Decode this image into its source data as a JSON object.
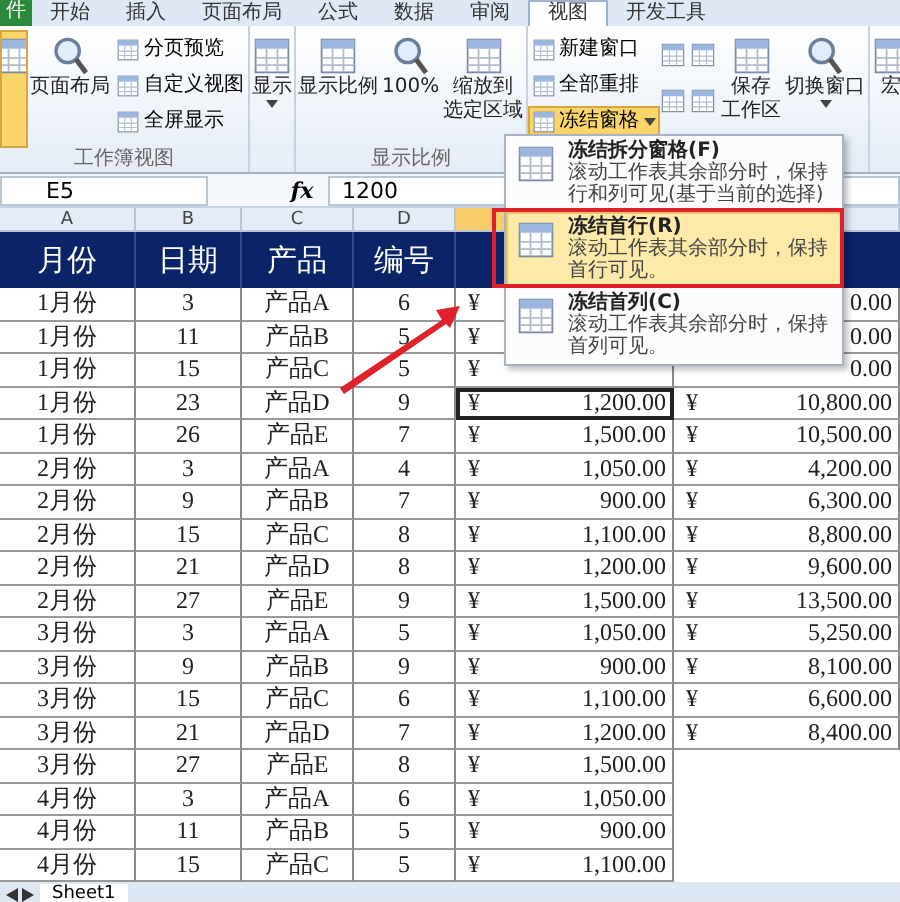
{
  "ribbon": {
    "file_tab": "件",
    "tabs": [
      {
        "label": "开始",
        "selected": false
      },
      {
        "label": "插入",
        "selected": false
      },
      {
        "label": "页面布局",
        "selected": false
      },
      {
        "label": "公式",
        "selected": false
      },
      {
        "label": "数据",
        "selected": false
      },
      {
        "label": "审阅",
        "selected": false
      },
      {
        "label": "视图",
        "selected": true
      },
      {
        "label": "开发工具",
        "selected": false
      }
    ],
    "groups": [
      {
        "label": "工作簿视图",
        "items": [
          {
            "kind": "large",
            "selected": true
          },
          {
            "kind": "large",
            "label": "页面布局",
            "selected": false
          },
          {
            "kind": "stack",
            "items": [
              {
                "label": "分页预览",
                "open": false
              },
              {
                "label": "自定义视图",
                "open": false
              },
              {
                "label": "全屏显示",
                "open": false
              }
            ]
          }
        ]
      },
      {
        "items": [
          {
            "kind": "large",
            "label": "显示",
            "selected": false,
            "dropdown": true
          }
        ]
      },
      {
        "label": "显示比例",
        "items": [
          {
            "kind": "large",
            "label": "显示比例",
            "selected": false
          },
          {
            "kind": "large",
            "label": "100%",
            "selected": false
          },
          {
            "kind": "large",
            "label": [
              "缩放到",
              "选定区域"
            ],
            "selected": false
          }
        ]
      },
      {
        "items": [
          {
            "kind": "stack",
            "items": [
              {
                "label": "新建窗口",
                "open": false
              },
              {
                "label": "全部重排",
                "open": false
              },
              {
                "label": "冻结窗格",
                "open": true,
                "dropdown": true
              }
            ]
          },
          {
            "kind": "icons"
          },
          {
            "kind": "icons"
          },
          {
            "kind": "large",
            "label": [
              "保存",
              "工作区"
            ],
            "selected": false
          },
          {
            "kind": "large",
            "label": "切换窗口",
            "selected": false,
            "dropdown": true
          }
        ]
      },
      {
        "items": [
          {
            "kind": "large",
            "label": "宏",
            "selected": false
          }
        ]
      }
    ]
  },
  "formula_bar": {
    "name_box": "E5",
    "function_label": "fx",
    "formula": "1200"
  },
  "columns": [
    {
      "label": "A",
      "selected": false
    },
    {
      "label": "B",
      "selected": false
    },
    {
      "label": "C",
      "selected": false
    },
    {
      "label": "D",
      "selected": false
    },
    {
      "selected": true
    },
    {
      "selected": false
    }
  ],
  "table": {
    "headers": [
      "月份",
      "日期",
      "产品",
      "编号"
    ],
    "rows": [
      {
        "month": "1月份",
        "day": "3",
        "product": "产品A",
        "number": "6",
        "e": {
          "currency": "¥"
        },
        "f": {
          "amount": "0.00"
        },
        "active": false
      },
      {
        "month": "1月份",
        "day": "11",
        "product": "产品B",
        "number": "5",
        "e": {
          "currency": "¥"
        },
        "f": {
          "amount": "0.00"
        },
        "active": false
      },
      {
        "month": "1月份",
        "day": "15",
        "product": "产品C",
        "number": "5",
        "e": {
          "currency": "¥"
        },
        "f": {
          "amount": "0.00"
        },
        "active": false
      },
      {
        "month": "1月份",
        "day": "23",
        "product": "产品D",
        "number": "9",
        "e": {
          "currency": "¥",
          "amount": "1,200.00"
        },
        "f": {
          "currency": "¥",
          "amount": "10,800.00"
        },
        "active": true
      },
      {
        "month": "1月份",
        "day": "26",
        "product": "产品E",
        "number": "7",
        "e": {
          "currency": "¥",
          "amount": "1,500.00"
        },
        "f": {
          "currency": "¥",
          "amount": "10,500.00"
        },
        "active": false
      },
      {
        "month": "2月份",
        "day": "3",
        "product": "产品A",
        "number": "4",
        "e": {
          "currency": "¥",
          "amount": "1,050.00"
        },
        "f": {
          "currency": "¥",
          "amount": "4,200.00"
        },
        "active": false
      },
      {
        "month": "2月份",
        "day": "9",
        "product": "产品B",
        "number": "7",
        "e": {
          "currency": "¥",
          "amount": "900.00"
        },
        "f": {
          "currency": "¥",
          "amount": "6,300.00"
        },
        "active": false
      },
      {
        "month": "2月份",
        "day": "15",
        "product": "产品C",
        "number": "8",
        "e": {
          "currency": "¥",
          "amount": "1,100.00"
        },
        "f": {
          "currency": "¥",
          "amount": "8,800.00"
        },
        "active": false
      },
      {
        "month": "2月份",
        "day": "21",
        "product": "产品D",
        "number": "8",
        "e": {
          "currency": "¥",
          "amount": "1,200.00"
        },
        "f": {
          "currency": "¥",
          "amount": "9,600.00"
        },
        "active": false
      },
      {
        "month": "2月份",
        "day": "27",
        "product": "产品E",
        "number": "9",
        "e": {
          "currency": "¥",
          "amount": "1,500.00"
        },
        "f": {
          "currency": "¥",
          "amount": "13,500.00"
        },
        "active": false
      },
      {
        "month": "3月份",
        "day": "3",
        "product": "产品A",
        "number": "5",
        "e": {
          "currency": "¥",
          "amount": "1,050.00"
        },
        "f": {
          "currency": "¥",
          "amount": "5,250.00"
        },
        "active": false
      },
      {
        "month": "3月份",
        "day": "9",
        "product": "产品B",
        "number": "9",
        "e": {
          "currency": "¥",
          "amount": "900.00"
        },
        "f": {
          "currency": "¥",
          "amount": "8,100.00"
        },
        "active": false
      },
      {
        "month": "3月份",
        "day": "15",
        "product": "产品C",
        "number": "6",
        "e": {
          "currency": "¥",
          "amount": "1,100.00"
        },
        "f": {
          "currency": "¥",
          "amount": "6,600.00"
        },
        "active": false
      },
      {
        "month": "3月份",
        "day": "21",
        "product": "产品D",
        "number": "7",
        "e": {
          "currency": "¥",
          "amount": "1,200.00"
        },
        "f": {
          "currency": "¥",
          "amount": "8,400.00"
        },
        "active": false
      },
      {
        "month": "3月份",
        "day": "27",
        "product": "产品E",
        "number": "8",
        "e": {
          "currency": "¥",
          "amount": "1,500.00"
        },
        "active": false
      },
      {
        "month": "4月份",
        "day": "3",
        "product": "产品A",
        "number": "6",
        "e": {
          "currency": "¥",
          "amount": "1,050.00"
        },
        "active": false
      },
      {
        "month": "4月份",
        "day": "11",
        "product": "产品B",
        "number": "5",
        "e": {
          "currency": "¥",
          "amount": "900.00"
        },
        "active": false
      },
      {
        "month": "4月份",
        "day": "15",
        "product": "产品C",
        "number": "5",
        "e": {
          "currency": "¥",
          "amount": "1,100.00"
        },
        "active": false
      }
    ]
  },
  "sheet_tabs": [
    {
      "label": "Sheet1",
      "selected": true
    }
  ],
  "menu": {
    "items": [
      {
        "title": "冻结拆分窗格(F)",
        "description": "滚动工作表其余部分时，保持行和列可见(基于当前的选择)",
        "selected": false
      },
      {
        "title": "冻结首行(R)",
        "description": "滚动工作表其余部分时，保持首行可见。",
        "selected": true
      },
      {
        "title": "冻结首列(C)",
        "description": "滚动工作表其余部分时，保持首列可见。",
        "selected": false
      }
    ]
  }
}
